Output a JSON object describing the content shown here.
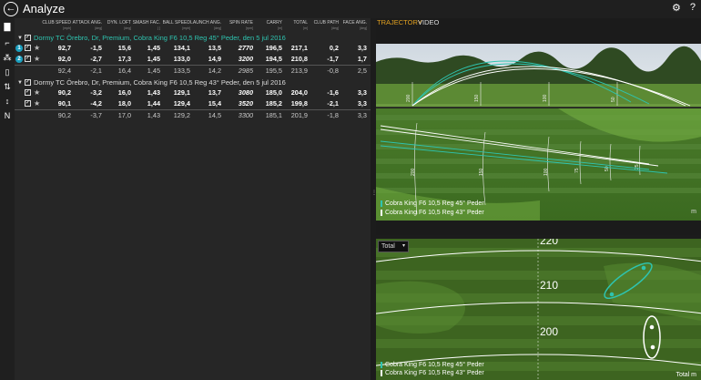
{
  "app": {
    "title": "Analyze"
  },
  "top_icons": {
    "settings": "⚙",
    "help": "?"
  },
  "columns": [
    {
      "label": "CLUB SPEED",
      "unit": "[mph]"
    },
    {
      "label": "ATTACK ANG.",
      "unit": "[deg]"
    },
    {
      "label": "DYN. LOFT",
      "unit": "[deg]"
    },
    {
      "label": "SMASH FAC.",
      "unit": "[ ]"
    },
    {
      "label": "BALL SPEED",
      "unit": "[mph]"
    },
    {
      "label": "LAUNCH ANG.",
      "unit": "[deg]"
    },
    {
      "label": "SPIN RATE",
      "unit": "[rpm]"
    },
    {
      "label": "CARRY",
      "unit": "[m]"
    },
    {
      "label": "TOTAL",
      "unit": "[m]"
    },
    {
      "label": "CLUB PATH",
      "unit": "[deg]"
    },
    {
      "label": "FACE ANG.",
      "unit": "[deg]"
    }
  ],
  "groups": [
    {
      "title": "Dormy TC Örebro, Dr, Premium, Cobra King F6 10,5 Reg 45° Peder, den 5 jul 2016",
      "rows": [
        {
          "badge": "1",
          "values": [
            "92,7",
            "-1,5",
            "15,6",
            "1,45",
            "134,1",
            "13,5",
            "2770",
            "196,5",
            "217,1",
            "0,2",
            "3,3"
          ]
        },
        {
          "badge": "2",
          "values": [
            "92,0",
            "-2,7",
            "17,3",
            "1,45",
            "133,0",
            "14,9",
            "3200",
            "194,5",
            "210,8",
            "-1,7",
            "1,7"
          ]
        }
      ],
      "average": [
        "92,4",
        "-2,1",
        "16,4",
        "1,45",
        "133,5",
        "14,2",
        "2985",
        "195,5",
        "213,9",
        "-0,8",
        "2,5"
      ]
    },
    {
      "title": "Dormy TC Örebro, Dr, Premium, Cobra King F6 10,5 Reg 43° Peder, den 5 jul 2016",
      "rows": [
        {
          "badge": "",
          "values": [
            "90,2",
            "-3,2",
            "16,0",
            "1,43",
            "129,1",
            "13,7",
            "3080",
            "185,0",
            "204,0",
            "-1,6",
            "3,3"
          ]
        },
        {
          "badge": "",
          "values": [
            "90,1",
            "-4,2",
            "18,0",
            "1,44",
            "129,4",
            "15,4",
            "3520",
            "185,2",
            "199,8",
            "-2,1",
            "3,3"
          ]
        }
      ],
      "average": [
        "90,2",
        "-3,7",
        "17,0",
        "1,43",
        "129,2",
        "14,5",
        "3300",
        "185,1",
        "201,9",
        "-1,8",
        "3,3"
      ]
    }
  ],
  "tabs": {
    "trajectory": "TRAJECTORY",
    "video": "VIDEO"
  },
  "trajectory": {
    "side_markers": [
      "200",
      "150",
      "100",
      "50"
    ],
    "top_markers": [
      "200",
      "150",
      "100",
      "75",
      "50",
      "25"
    ],
    "legend": [
      {
        "label": "Cobra King F6 10,5 Reg 45° Peder",
        "color": "#2ec4b0"
      },
      {
        "label": "Cobra King F6 10,5 Reg 43° Peder",
        "color": "#ffffff"
      }
    ],
    "unit": "m"
  },
  "dispersion": {
    "select_value": "Total",
    "range_labels": [
      "220",
      "210",
      "200"
    ],
    "legend": [
      {
        "label": "Cobra King F6 10,5 Reg 45° Peder",
        "color": "#2ec4b0"
      },
      {
        "label": "Cobra King F6 10,5 Reg 43° Peder",
        "color": "#ffffff"
      }
    ],
    "unit_label": "Total m"
  },
  "colors": {
    "accent": "#e0a020",
    "series1": "#2ec4b0",
    "series2": "#ffffff",
    "badge": "#1aa0c0"
  }
}
